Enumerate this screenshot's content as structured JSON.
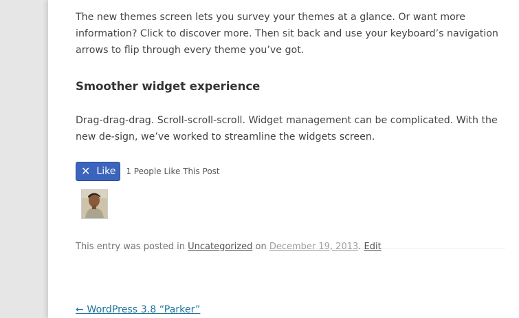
{
  "post": {
    "paragraph_themes": "The new themes screen lets you survey your themes at a glance. Or want more information? Click to discover more. Then sit back and use your keyboard’s navigation arrows to flip through every theme you’ve got.",
    "heading_widgets": "Smoother widget experience",
    "paragraph_widgets": "Drag-drag-drag. Scroll-scroll-scroll. Widget management can be complicated. With the new de-sign, we’ve worked to streamline the widgets screen."
  },
  "likes": {
    "button_label": "Like",
    "count_text": "1 People Like This Post",
    "icon": "x-icon",
    "button_color": "#3b64bd"
  },
  "entry_meta": {
    "prefix": "This entry was posted in ",
    "category": "Uncategorized",
    "on_text": " on ",
    "date": "December 19, 2013",
    "separator": ". ",
    "edit_label": "Edit"
  },
  "navigation": {
    "previous_label": "← WordPress 3.8 “Parker”",
    "link_color": "#21759b"
  }
}
